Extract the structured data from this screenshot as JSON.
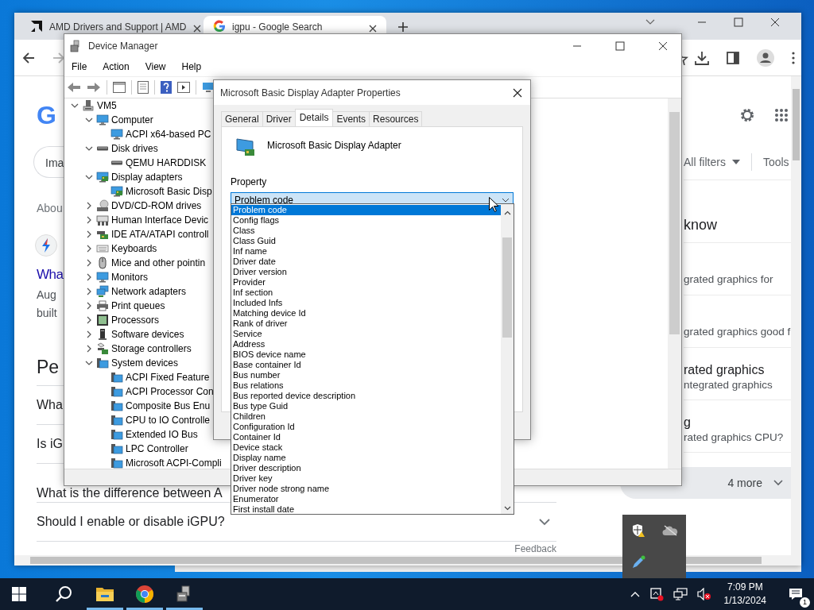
{
  "browser": {
    "tabs": [
      {
        "title": "AMD Drivers and Support | AMD",
        "kind": "amd",
        "selected": false
      },
      {
        "title": "igpu - Google Search",
        "kind": "google",
        "selected": true
      }
    ],
    "page": {
      "logo": "G",
      "chip": "Ima",
      "about": "Abou",
      "result": {
        "title": "Wha",
        "date": "Aug",
        "snippet": "built"
      },
      "people_also_ask": {
        "heading": "Pe",
        "questions": [
          "Wha",
          "Is iG",
          "What is the difference between A",
          "Should I enable or disable iGPU?"
        ]
      },
      "feedback": "Feedback",
      "filters": "All filters",
      "tools": "Tools",
      "panel_heading": "know",
      "panel_items": [
        {
          "text": "grated graphics for"
        },
        {
          "text": "grated graphics good f"
        },
        {
          "title": "rated graphics",
          "text": "ntegrated graphics"
        },
        {
          "title": "g",
          "text": "rated graphics CPU?"
        }
      ],
      "more": "4 more"
    }
  },
  "device_manager": {
    "title": "Device Manager",
    "menu": [
      "File",
      "Action",
      "View",
      "Help"
    ],
    "tree": [
      {
        "label": "VM5",
        "kind": "pc",
        "expanded": true,
        "children": [
          {
            "label": "Computer",
            "kind": "monitor",
            "expanded": true,
            "children": [
              {
                "label": "ACPI x64-based PC",
                "kind": "monitor"
              }
            ]
          },
          {
            "label": "Disk drives",
            "kind": "disk",
            "expanded": true,
            "children": [
              {
                "label": "QEMU HARDDISK",
                "kind": "disk"
              }
            ]
          },
          {
            "label": "Display adapters",
            "kind": "display",
            "expanded": true,
            "children": [
              {
                "label": "Microsoft Basic Disp",
                "kind": "display"
              }
            ]
          },
          {
            "label": "DVD/CD-ROM drives",
            "kind": "dvd",
            "expanded": false
          },
          {
            "label": "Human Interface Devic",
            "kind": "hid",
            "expanded": false
          },
          {
            "label": "IDE ATA/ATAPI controll",
            "kind": "ide",
            "expanded": false
          },
          {
            "label": "Keyboards",
            "kind": "keyboard",
            "expanded": false
          },
          {
            "label": "Mice and other pointin",
            "kind": "mouse",
            "expanded": false
          },
          {
            "label": "Monitors",
            "kind": "monitor",
            "expanded": false
          },
          {
            "label": "Network adapters",
            "kind": "network",
            "expanded": false
          },
          {
            "label": "Print queues",
            "kind": "printer",
            "expanded": false
          },
          {
            "label": "Processors",
            "kind": "processor",
            "expanded": false
          },
          {
            "label": "Software devices",
            "kind": "software",
            "expanded": false
          },
          {
            "label": "Storage controllers",
            "kind": "storage",
            "expanded": false
          },
          {
            "label": "System devices",
            "kind": "system",
            "expanded": true,
            "children": [
              {
                "label": "ACPI Fixed Feature",
                "kind": "system"
              },
              {
                "label": "ACPI Processor Con",
                "kind": "system"
              },
              {
                "label": "Composite Bus Enu",
                "kind": "system"
              },
              {
                "label": "CPU to IO Controlle",
                "kind": "system"
              },
              {
                "label": "Extended IO Bus",
                "kind": "system"
              },
              {
                "label": "LPC Controller",
                "kind": "system"
              },
              {
                "label": "Microsoft ACPI-Compli",
                "kind": "system"
              }
            ]
          }
        ]
      }
    ]
  },
  "properties_dialog": {
    "title": "Microsoft Basic Display Adapter Properties",
    "tabs": [
      {
        "label": "General",
        "selected": false
      },
      {
        "label": "Driver",
        "selected": false
      },
      {
        "label": "Details",
        "selected": true
      },
      {
        "label": "Events",
        "selected": false
      },
      {
        "label": "Resources",
        "selected": false
      }
    ],
    "device_name": "Microsoft Basic Display Adapter",
    "property_label": "Property",
    "property_value": "Problem code",
    "options": [
      {
        "label": "Problem code",
        "selected": true
      },
      {
        "label": "Config flags",
        "selected": false
      },
      {
        "label": "Class",
        "selected": false
      },
      {
        "label": "Class Guid",
        "selected": false
      },
      {
        "label": "Inf name",
        "selected": false
      },
      {
        "label": "Driver date",
        "selected": false
      },
      {
        "label": "Driver version",
        "selected": false
      },
      {
        "label": "Provider",
        "selected": false
      },
      {
        "label": "Inf section",
        "selected": false
      },
      {
        "label": "Included Infs",
        "selected": false
      },
      {
        "label": "Matching device Id",
        "selected": false
      },
      {
        "label": "Rank of driver",
        "selected": false
      },
      {
        "label": "Service",
        "selected": false
      },
      {
        "label": "Address",
        "selected": false
      },
      {
        "label": "BIOS device name",
        "selected": false
      },
      {
        "label": "Base container Id",
        "selected": false
      },
      {
        "label": "Bus number",
        "selected": false
      },
      {
        "label": "Bus relations",
        "selected": false
      },
      {
        "label": "Bus reported device description",
        "selected": false
      },
      {
        "label": "Bus type Guid",
        "selected": false
      },
      {
        "label": "Children",
        "selected": false
      },
      {
        "label": "Configuration Id",
        "selected": false
      },
      {
        "label": "Container Id",
        "selected": false
      },
      {
        "label": "Device stack",
        "selected": false
      },
      {
        "label": "Display name",
        "selected": false
      },
      {
        "label": "Driver description",
        "selected": false
      },
      {
        "label": "Driver key",
        "selected": false
      },
      {
        "label": "Driver node strong name",
        "selected": false
      },
      {
        "label": "Enumerator",
        "selected": false
      },
      {
        "label": "First install date",
        "selected": false
      }
    ]
  },
  "taskbar": {
    "apps": [
      {
        "kind": "explorer",
        "running": true
      },
      {
        "kind": "chrome",
        "running": true
      },
      {
        "kind": "device-manager",
        "running": true
      }
    ],
    "time": "7:09 PM",
    "date": "1/13/2024",
    "notifications": "1"
  }
}
